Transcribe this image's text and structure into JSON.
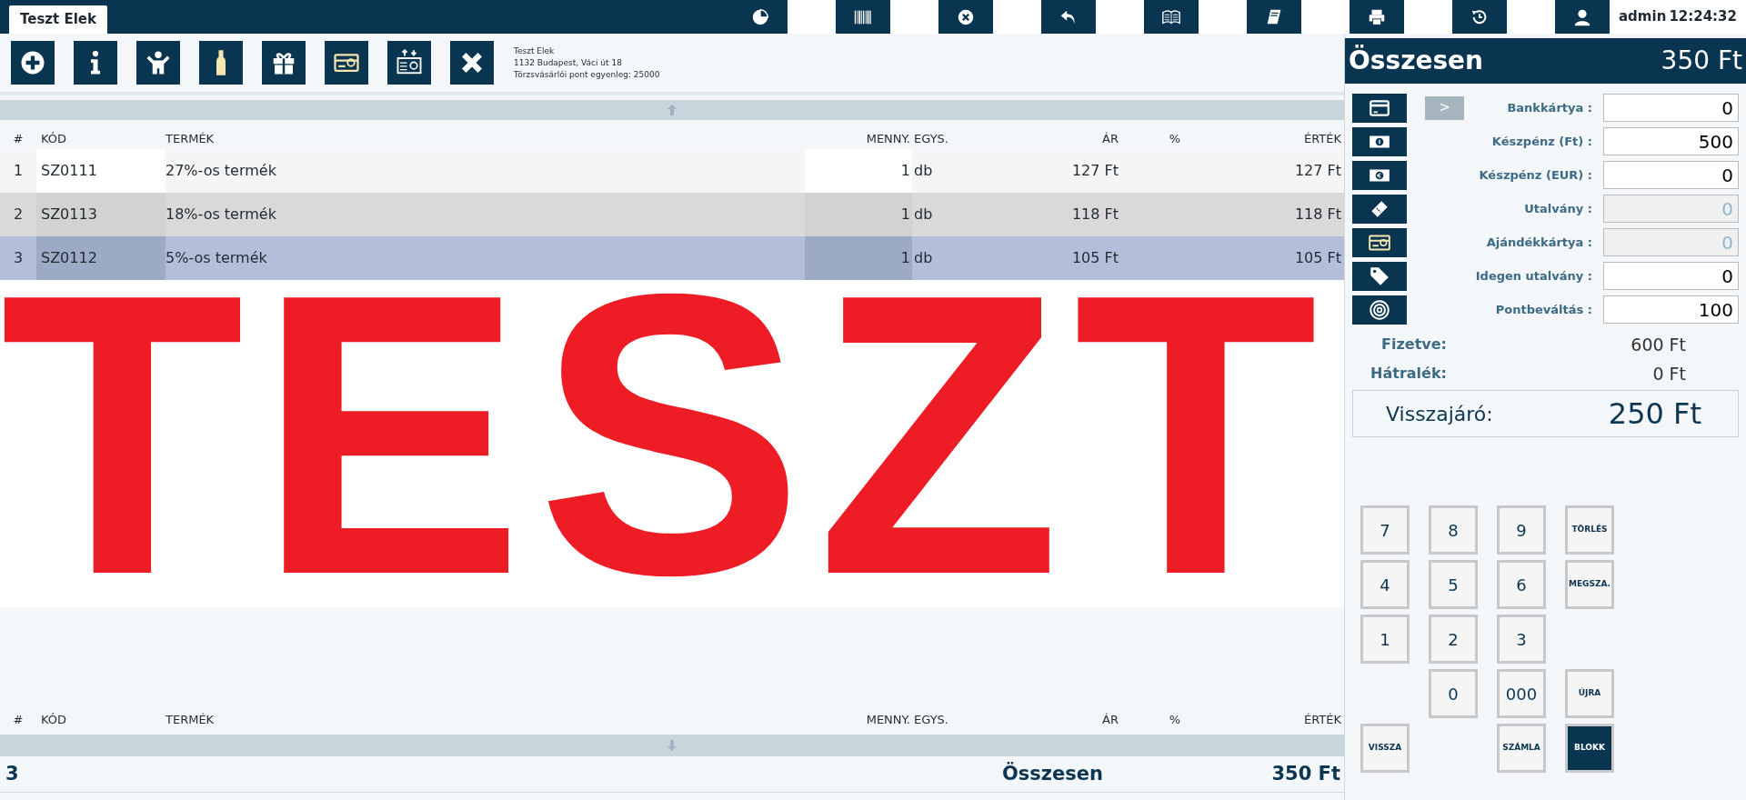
{
  "top_bar": {
    "tab": {
      "label": "Teszt Elek",
      "selected": true
    },
    "user": "admin",
    "time": "12:24:32"
  },
  "toolbar": {
    "customer": {
      "name": "Teszt Elek",
      "address": "1132 Budapest, Váci út 18",
      "points": "Törzsvásárlói pont egyenleg: 25000"
    }
  },
  "table": {
    "columns": [
      "#",
      "KÓD",
      "TERMÉK",
      "MENNY.",
      "EGYS.",
      "ÁR",
      "%",
      "ÉRTÉK"
    ],
    "rows": [
      {
        "num": "1",
        "code": "SZ0111",
        "product": "27%-os termék",
        "qty": "1",
        "unit": "db",
        "price": "127 Ft",
        "percent": "",
        "value": "127 Ft",
        "selected": false
      },
      {
        "num": "2",
        "code": "SZ0113",
        "product": "18%-os termék",
        "qty": "1",
        "unit": "db",
        "price": "118 Ft",
        "percent": "",
        "value": "118 Ft",
        "selected": false
      },
      {
        "num": "3",
        "code": "SZ0112",
        "product": "5%-os termék",
        "qty": "1",
        "unit": "db",
        "price": "105 Ft",
        "percent": "",
        "value": "105 Ft",
        "selected": true
      }
    ]
  },
  "banner": "TESZT",
  "footer_columns": [
    "#",
    "KÓD",
    "TERMÉK",
    "MENNY.",
    "EGYS.",
    "ÁR",
    "%",
    "ÉRTÉK"
  ],
  "footer": {
    "count": "3",
    "label": "Összesen",
    "total": "350 Ft"
  },
  "payment": {
    "title": "Összesen",
    "total": "350 Ft",
    "expand_button": ">",
    "methods": [
      {
        "label": "Bankkártya :",
        "value": "0",
        "disabled": false
      },
      {
        "label": "Készpénz (Ft) :",
        "value": "500",
        "disabled": false
      },
      {
        "label": "Készpénz (EUR) :",
        "value": "0",
        "disabled": false
      },
      {
        "label": "Utalvány :",
        "value": "0",
        "disabled": true
      },
      {
        "label": "Ajándékkártya :",
        "value": "0",
        "disabled": true
      },
      {
        "label": "Idegen utalvány :",
        "value": "0",
        "disabled": false
      },
      {
        "label": "Pontbeváltás :",
        "value": "100",
        "disabled": false
      }
    ],
    "paid_label": "Fizetve:",
    "paid": "600 Ft",
    "due_label": "Hátralék:",
    "due": "0 Ft",
    "change_label": "Visszajáró:",
    "change": "250 Ft"
  },
  "keypad": [
    {
      "label": "7",
      "kind": "digit"
    },
    {
      "label": "8",
      "kind": "digit"
    },
    {
      "label": "9",
      "kind": "digit"
    },
    {
      "label": "TÖRLÉS",
      "kind": "action"
    },
    {
      "label": "4",
      "kind": "digit"
    },
    {
      "label": "5",
      "kind": "digit"
    },
    {
      "label": "6",
      "kind": "digit"
    },
    {
      "label": "MEGSZA.",
      "kind": "action"
    },
    {
      "label": "1",
      "kind": "digit"
    },
    {
      "label": "2",
      "kind": "digit"
    },
    {
      "label": "3",
      "kind": "digit"
    },
    {
      "label": "0",
      "kind": "digit"
    },
    {
      "label": "000",
      "kind": "digit"
    },
    {
      "label": "ÚJRA",
      "kind": "action"
    },
    {
      "label": "VISSZA",
      "kind": "action"
    },
    {
      "label": "SZÁMLA",
      "kind": "action"
    },
    {
      "label": "BLOKK",
      "kind": "primary"
    }
  ]
}
